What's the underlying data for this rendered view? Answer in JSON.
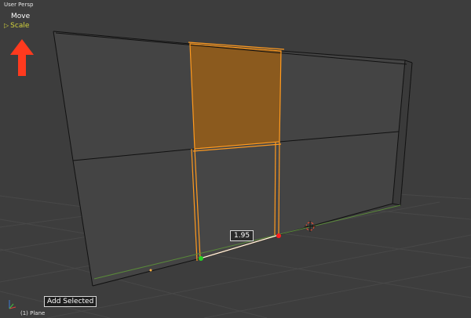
{
  "viewport": {
    "view_label": "User Persp",
    "object_info": "(1) Plane"
  },
  "history": {
    "items": [
      {
        "label": "Move"
      },
      {
        "label": "Scale",
        "active": true
      }
    ],
    "active_marker": "▷"
  },
  "edge_slide": {
    "value": "1.95",
    "action_label": "Add Selected"
  },
  "colors": {
    "background": "#3d3d3d",
    "selection": "#ff9a1f",
    "face_selected": "#8b5a1e",
    "active_history": "#d2d23c",
    "annotation_arrow": "#ff3a1e"
  },
  "icons": {
    "annotation": "red-up-arrow-icon",
    "axes": "axis-gizmo-icon",
    "cursor": "3d-cursor-icon"
  }
}
